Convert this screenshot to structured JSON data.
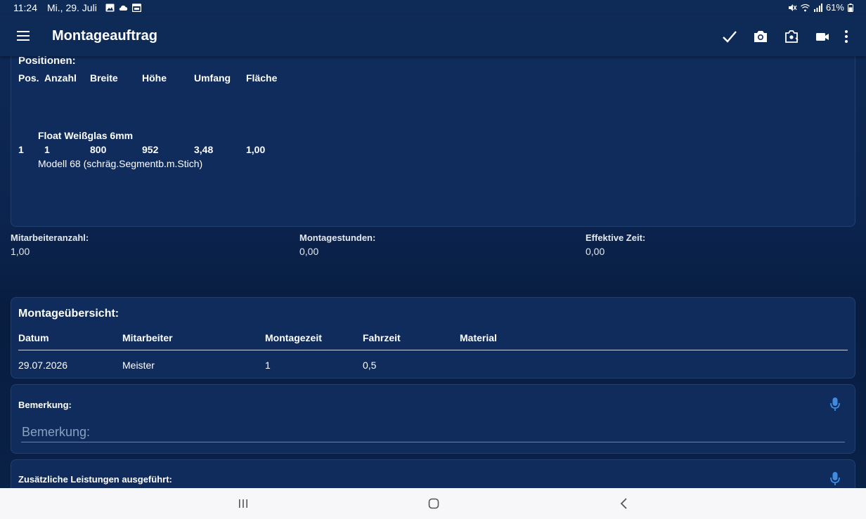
{
  "status": {
    "time": "11:24",
    "date": "Mi., 29. Juli",
    "battery": "61%"
  },
  "appbar": {
    "title": "Montageauftrag"
  },
  "positions": {
    "title": "Positionen:",
    "headers": [
      "Pos.",
      "Anzahl",
      "Breite",
      "Höhe",
      "Umfang",
      "Fläche"
    ],
    "item": {
      "name": "Float Weißglas 6mm",
      "pos": "1",
      "anzahl": "1",
      "breite": "800",
      "hoehe": "952",
      "umfang": "3,48",
      "flaeche": "1,00",
      "model": "Modell 68 (schräg.Segmentb.m.Stich)"
    }
  },
  "stats": {
    "mitarbeiter_label": "Mitarbeiteranzahl:",
    "mitarbeiter_value": "1,00",
    "stunden_label": "Montagestunden:",
    "stunden_value": "0,00",
    "zeit_label": "Effektive Zeit:",
    "zeit_value": "0,00"
  },
  "overview": {
    "title": "Montageübersicht:",
    "headers": [
      "Datum",
      "Mitarbeiter",
      "Montagezeit",
      "Fahrzeit",
      "Material"
    ],
    "row": {
      "datum": "29.07.2026",
      "mitarbeiter": "Meister",
      "montagezeit": "1",
      "fahrzeit": "0,5",
      "material": ""
    }
  },
  "remark": {
    "label": "Bemerkung:",
    "placeholder": "Bemerkung:"
  },
  "extra": {
    "label": "Zusätzliche Leistungen ausgeführt:"
  },
  "colors": {
    "background": "#0e2a56",
    "card": "#0f2c5c",
    "accent": "#3e8be0",
    "navbar": "#f7f7f9"
  }
}
